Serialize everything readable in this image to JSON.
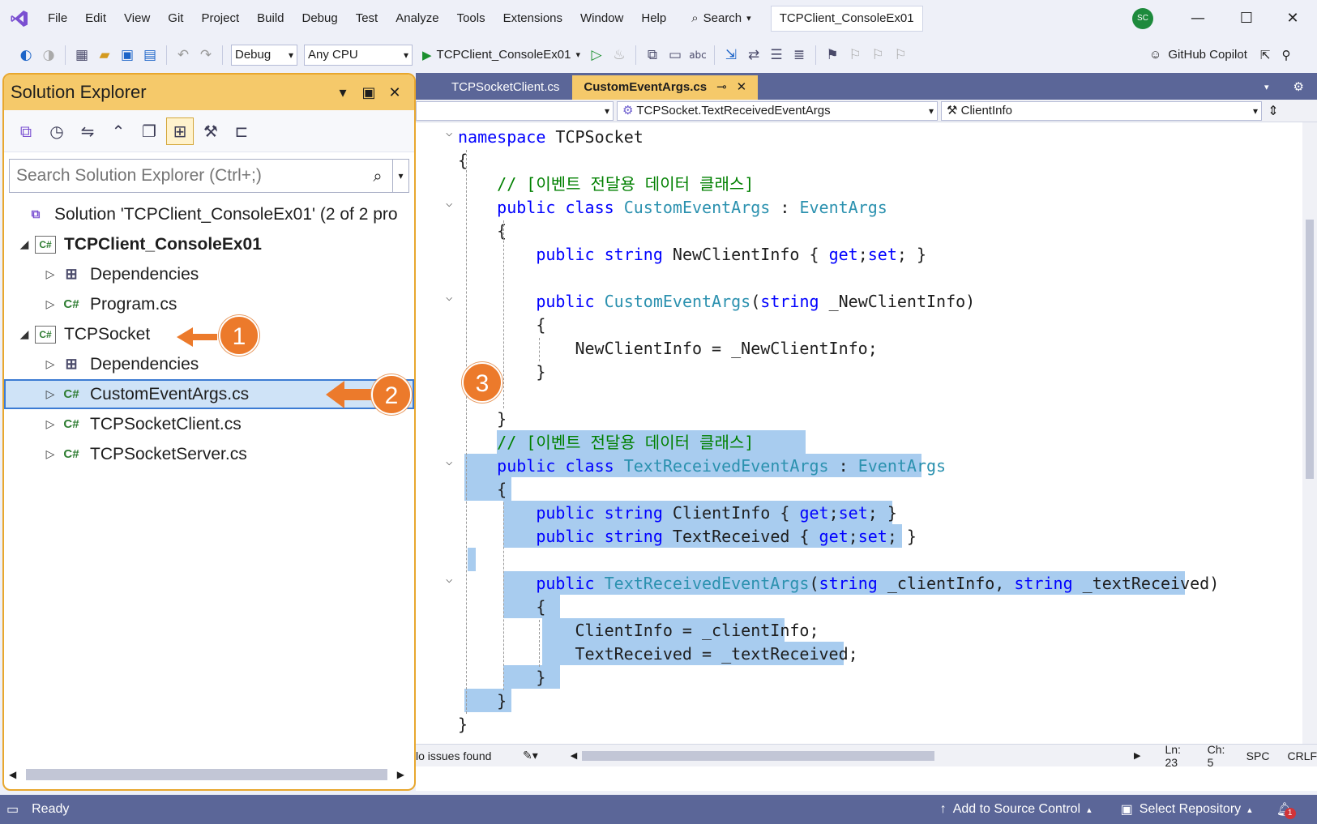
{
  "menu": [
    "File",
    "Edit",
    "View",
    "Git",
    "Project",
    "Build",
    "Debug",
    "Test",
    "Analyze",
    "Tools",
    "Extensions",
    "Window",
    "Help"
  ],
  "search_label": "Search",
  "window_title": "TCPClient_ConsoleEx01",
  "user_initials": "SC",
  "toolbar": {
    "config": "Debug",
    "platform": "Any CPU",
    "startup": "TCPClient_ConsoleEx01",
    "copilot": "GitHub Copilot"
  },
  "solution_explorer": {
    "title": "Solution Explorer",
    "search_placeholder": "Search Solution Explorer (Ctrl+;)",
    "solution": "Solution 'TCPClient_ConsoleEx01' (2 of 2 pro",
    "items": [
      {
        "label": "TCPClient_ConsoleEx01"
      },
      {
        "label": "Dependencies"
      },
      {
        "label": "Program.cs"
      },
      {
        "label": "TCPSocket"
      },
      {
        "label": "Dependencies"
      },
      {
        "label": "CustomEventArgs.cs"
      },
      {
        "label": "TCPSocketClient.cs"
      },
      {
        "label": "TCPSocketServer.cs"
      }
    ]
  },
  "callouts": [
    "1",
    "2",
    "3"
  ],
  "editor": {
    "tabs": [
      {
        "label": "TCPSocketClient.cs"
      },
      {
        "label": "CustomEventArgs.cs"
      }
    ],
    "nav_type": "TCPSocket.TextReceivedEventArgs",
    "nav_member": "ClientInfo",
    "status": {
      "issues": "lo issues found",
      "line": "Ln: 23",
      "col": "Ch: 5",
      "spc": "SPC",
      "eol": "CRLF"
    }
  },
  "code_lines": [
    {
      "segs": [
        [
          "kw",
          "namespace"
        ],
        [
          "",
          "TCPSocket"
        ]
      ]
    },
    {
      "segs": [
        [
          "",
          "{"
        ]
      ]
    },
    {
      "segs": [
        [
          "cm",
          "// [이벤트 전달용 데이터 클래스]"
        ]
      ]
    },
    {
      "segs": [
        [
          "kw",
          "public"
        ],
        [
          "kw",
          "class"
        ],
        [
          "ty",
          "CustomEventArgs"
        ],
        [
          "",
          ":"
        ],
        [
          "ty",
          "EventArgs"
        ]
      ]
    },
    {
      "segs": [
        [
          "",
          "{"
        ]
      ]
    },
    {
      "segs": [
        [
          "kw",
          "public"
        ],
        [
          "kw",
          "string"
        ],
        [
          "",
          "NewClientInfo {"
        ],
        [
          "kw",
          "get"
        ],
        [
          "",
          ";"
        ],
        [
          "kw",
          "set"
        ],
        [
          "",
          "; }"
        ]
      ]
    },
    {
      "segs": []
    },
    {
      "segs": [
        [
          "kw",
          "public"
        ],
        [
          "ty",
          "CustomEventArgs"
        ],
        [
          "",
          "("
        ],
        [
          "kw",
          "string"
        ],
        [
          "",
          "_NewClientInfo)"
        ]
      ]
    },
    {
      "segs": [
        [
          "",
          "{"
        ]
      ]
    },
    {
      "segs": [
        [
          "",
          "NewClientInfo = _NewClientInfo;"
        ]
      ]
    },
    {
      "segs": [
        [
          "",
          "}"
        ]
      ]
    },
    {
      "segs": []
    },
    {
      "segs": [
        [
          "",
          "}"
        ]
      ]
    },
    {
      "segs": [
        [
          "cm",
          "// [이벤트 전달용 데이터 클래스]"
        ]
      ]
    },
    {
      "segs": [
        [
          "kw",
          "public"
        ],
        [
          "kw",
          "class"
        ],
        [
          "ty",
          "TextReceivedEventArgs"
        ],
        [
          "",
          ":"
        ],
        [
          "ty",
          "EventArgs"
        ]
      ]
    },
    {
      "segs": [
        [
          "",
          "{"
        ]
      ]
    },
    {
      "segs": [
        [
          "kw",
          "public"
        ],
        [
          "kw",
          "string"
        ],
        [
          "",
          "ClientInfo {"
        ],
        [
          "kw",
          "get"
        ],
        [
          "",
          ";"
        ],
        [
          "kw",
          "set"
        ],
        [
          "",
          "; }"
        ]
      ]
    },
    {
      "segs": [
        [
          "kw",
          "public"
        ],
        [
          "kw",
          "string"
        ],
        [
          "",
          "TextReceived {"
        ],
        [
          "kw",
          "get"
        ],
        [
          "",
          ";"
        ],
        [
          "kw",
          "set"
        ],
        [
          "",
          "; }"
        ]
      ]
    },
    {
      "segs": []
    },
    {
      "segs": [
        [
          "kw",
          "public"
        ],
        [
          "ty",
          "TextReceivedEventArgs"
        ],
        [
          "",
          "("
        ],
        [
          "kw",
          "string"
        ],
        [
          "",
          "_clientInfo,"
        ],
        [
          "kw",
          "string"
        ],
        [
          "",
          "_textReceived)"
        ]
      ]
    },
    {
      "segs": [
        [
          "",
          "{"
        ]
      ]
    },
    {
      "segs": [
        [
          "",
          "ClientInfo = _clientInfo;"
        ]
      ]
    },
    {
      "segs": [
        [
          "",
          "TextReceived = _textReceived;"
        ]
      ]
    },
    {
      "segs": [
        [
          "",
          "}"
        ]
      ]
    },
    {
      "segs": [
        [
          "",
          "}"
        ]
      ]
    },
    {
      "segs": [
        [
          "",
          "}"
        ]
      ]
    }
  ],
  "statusbar": {
    "ready": "Ready",
    "source_control": "Add to Source Control",
    "repo": "Select Repository",
    "notif_count": "1"
  }
}
